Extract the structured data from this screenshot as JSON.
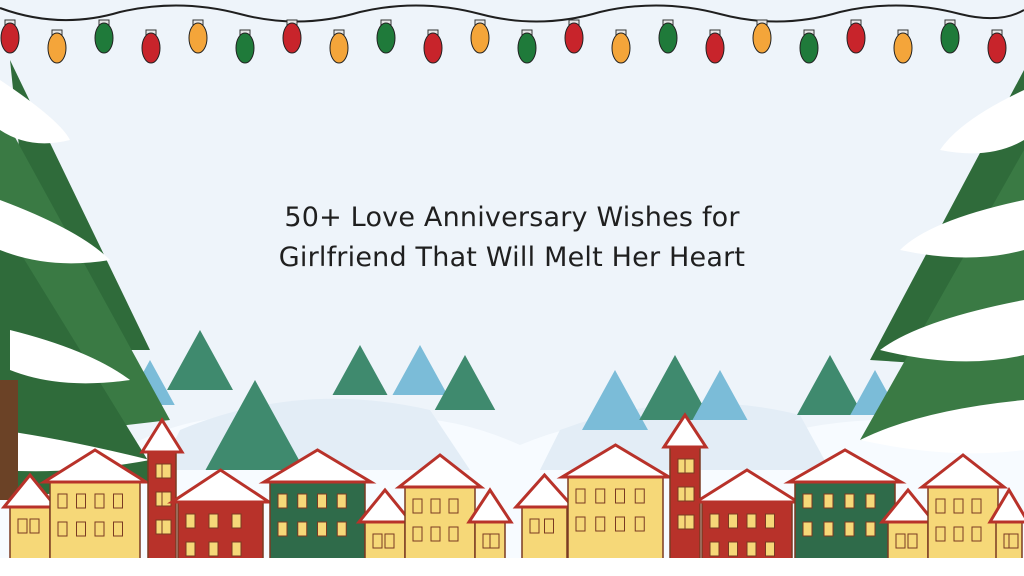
{
  "title": {
    "line1": "50+ Love Anniversary Wishes for",
    "line2": "Girlfriend That Will Melt Her Heart"
  },
  "colors": {
    "background": "#eef4fa",
    "pine_dark": "#2f6b3a",
    "pine_teal": "#3f8a6e",
    "pine_light": "#7bbcd8",
    "snow": "#ffffff",
    "bulb_red": "#c8242b",
    "bulb_green": "#1f7a3a",
    "bulb_orange": "#f4a53a",
    "house_yellow": "#f6d878",
    "house_red": "#b8322a",
    "house_green": "#2f6b4a"
  },
  "icons": [
    "string-lights",
    "pine-tree",
    "snow-ground",
    "house"
  ]
}
